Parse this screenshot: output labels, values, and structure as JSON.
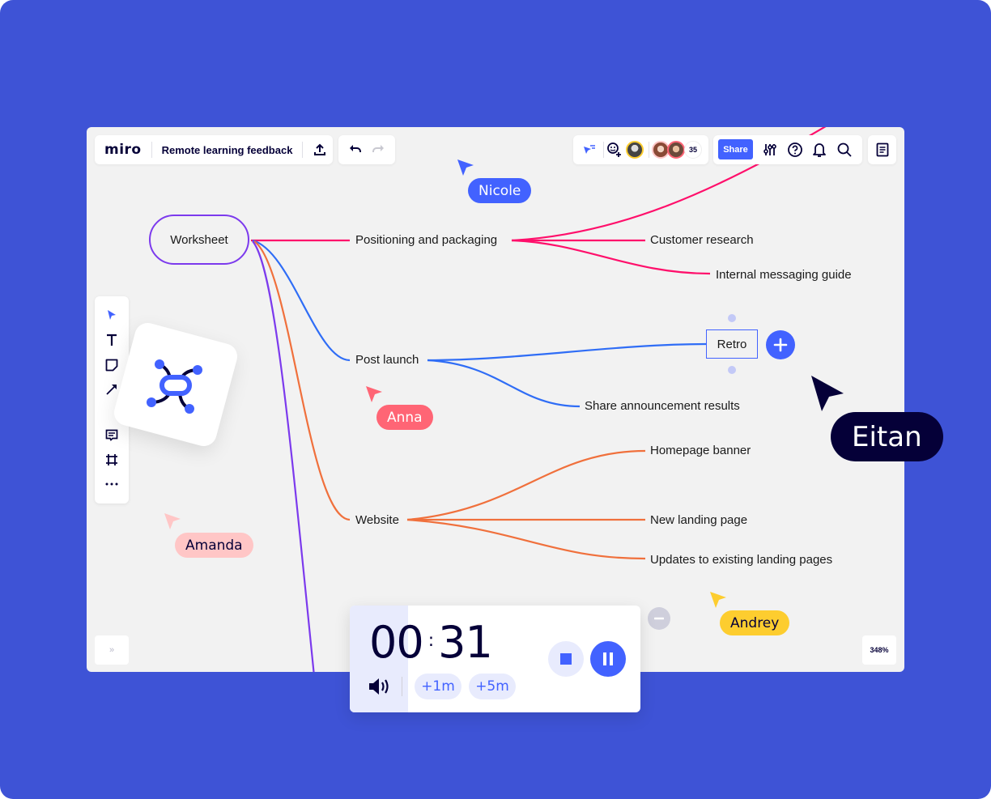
{
  "app": {
    "logo": "miro",
    "board_title": "Remote learning feedback"
  },
  "toolbar_top": {
    "collaborators_count": "35",
    "share_label": "Share",
    "icons": [
      "export-icon",
      "undo-icon",
      "redo-icon",
      "follow-cursor-icon",
      "invite-reaction-icon",
      "settings-sliders-icon",
      "help-icon",
      "bell-icon",
      "search-icon",
      "notes-icon"
    ]
  },
  "toolbar_left": {
    "tools": [
      "select-tool",
      "text-tool",
      "sticky-note-tool",
      "arrow-tool",
      "comment-tool",
      "frame-tool",
      "more-tools"
    ]
  },
  "mindmap": {
    "root": "Worksheet",
    "branches": [
      {
        "label": "Positioning and packaging",
        "color": "#ff0f6b",
        "children": [
          "Customer research",
          "Internal messaging guide"
        ]
      },
      {
        "label": "Post launch",
        "color": "#2f6df6",
        "children": [
          "Retro",
          "Share announcement results"
        ]
      },
      {
        "label": "Website",
        "color": "#f0703c",
        "children": [
          "Homepage banner",
          "New landing page",
          "Updates to existing landing pages"
        ]
      }
    ],
    "selected_node": "Retro"
  },
  "cursors": [
    {
      "name": "Nicole",
      "color": "#4262ff",
      "text_color": "#ffffff"
    },
    {
      "name": "Anna",
      "color": "#ff6575",
      "text_color": "#ffffff"
    },
    {
      "name": "Eitan",
      "color": "#050038",
      "text_color": "#ffffff"
    },
    {
      "name": "Amanda",
      "color": "#ffc6c6",
      "text_color": "#050038"
    },
    {
      "name": "Andrey",
      "color": "#fdcd2f",
      "text_color": "#050038"
    }
  ],
  "timer": {
    "minutes": "00",
    "seconds": "31",
    "add_1m_label": "+1m",
    "add_5m_label": "+5m",
    "progress_elapsed": 0.2
  },
  "zoom_level": "348%",
  "expand_label": "»",
  "colors": {
    "background": "#3e53d6",
    "accent": "#4262ff",
    "canvas": "#f2f2f2",
    "root_border": "#7c3aed"
  }
}
